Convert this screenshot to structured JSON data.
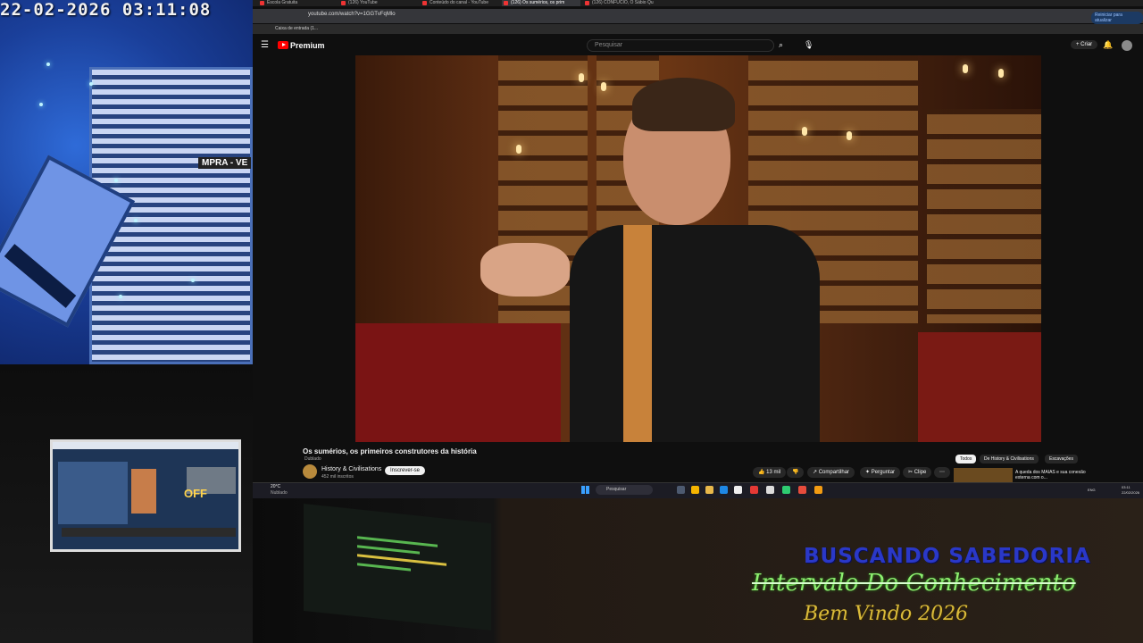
{
  "webcam": {
    "timestamp": "22-02-2026 03:11:08",
    "sign_text": "MPRA - VE"
  },
  "mini_monitor": {
    "status_text": "OFF"
  },
  "browser": {
    "tabs": [
      {
        "label": "Escola Gratuita",
        "active": false
      },
      {
        "label": "(126) YouTube",
        "active": false
      },
      {
        "label": "Conteúdo do canal - YouTube",
        "active": false
      },
      {
        "label": "(126) Os sumérios, os prim",
        "active": true
      },
      {
        "label": "(126) CONFUCIO, O Sábio Qu",
        "active": false
      }
    ],
    "url": "youtube.com/watch?v=1GGTvFqMlo",
    "restart_label": "Reiniciar para atualizar",
    "bookmark": "Caixa de entrada (1..."
  },
  "youtube": {
    "brand": "Premium",
    "search_placeholder": "Pesquisar",
    "create_label": "+ Criar",
    "video": {
      "title": "Os sumérios, os primeiros construtores da história",
      "tag": "Dublado",
      "channel": "History & Civilisations",
      "subscribers": "452 mil inscritos",
      "subscribe_label": "Inscrever-se",
      "likes": "13 mil",
      "share_label": "Compartilhar",
      "ask_label": "Perguntar",
      "clip_label": "Clipe"
    },
    "chips": [
      {
        "label": "Todos",
        "active": true
      },
      {
        "label": "De History & Civilisations",
        "active": false
      },
      {
        "label": "Escavações",
        "active": false
      }
    ],
    "recommended_title": "A queda dos MAIAS e sua conexão externa com o..."
  },
  "taskbar": {
    "weather_temp": "20°C",
    "weather_desc": "Nublado",
    "search_placeholder": "Pesquisar",
    "language": "ENG",
    "time": "03:11",
    "date": "22/02/2026"
  },
  "overlay": {
    "line1": "BUSCANDO SABEDORIA",
    "line2": "Intervalo Do Conhecimento",
    "line3": "Bem Vindo 2026"
  },
  "colors": {
    "youtube_red": "#ff0000",
    "overlay_blue": "#2a38c8",
    "overlay_green": "#8df070",
    "overlay_gold": "#d9ba3a"
  }
}
